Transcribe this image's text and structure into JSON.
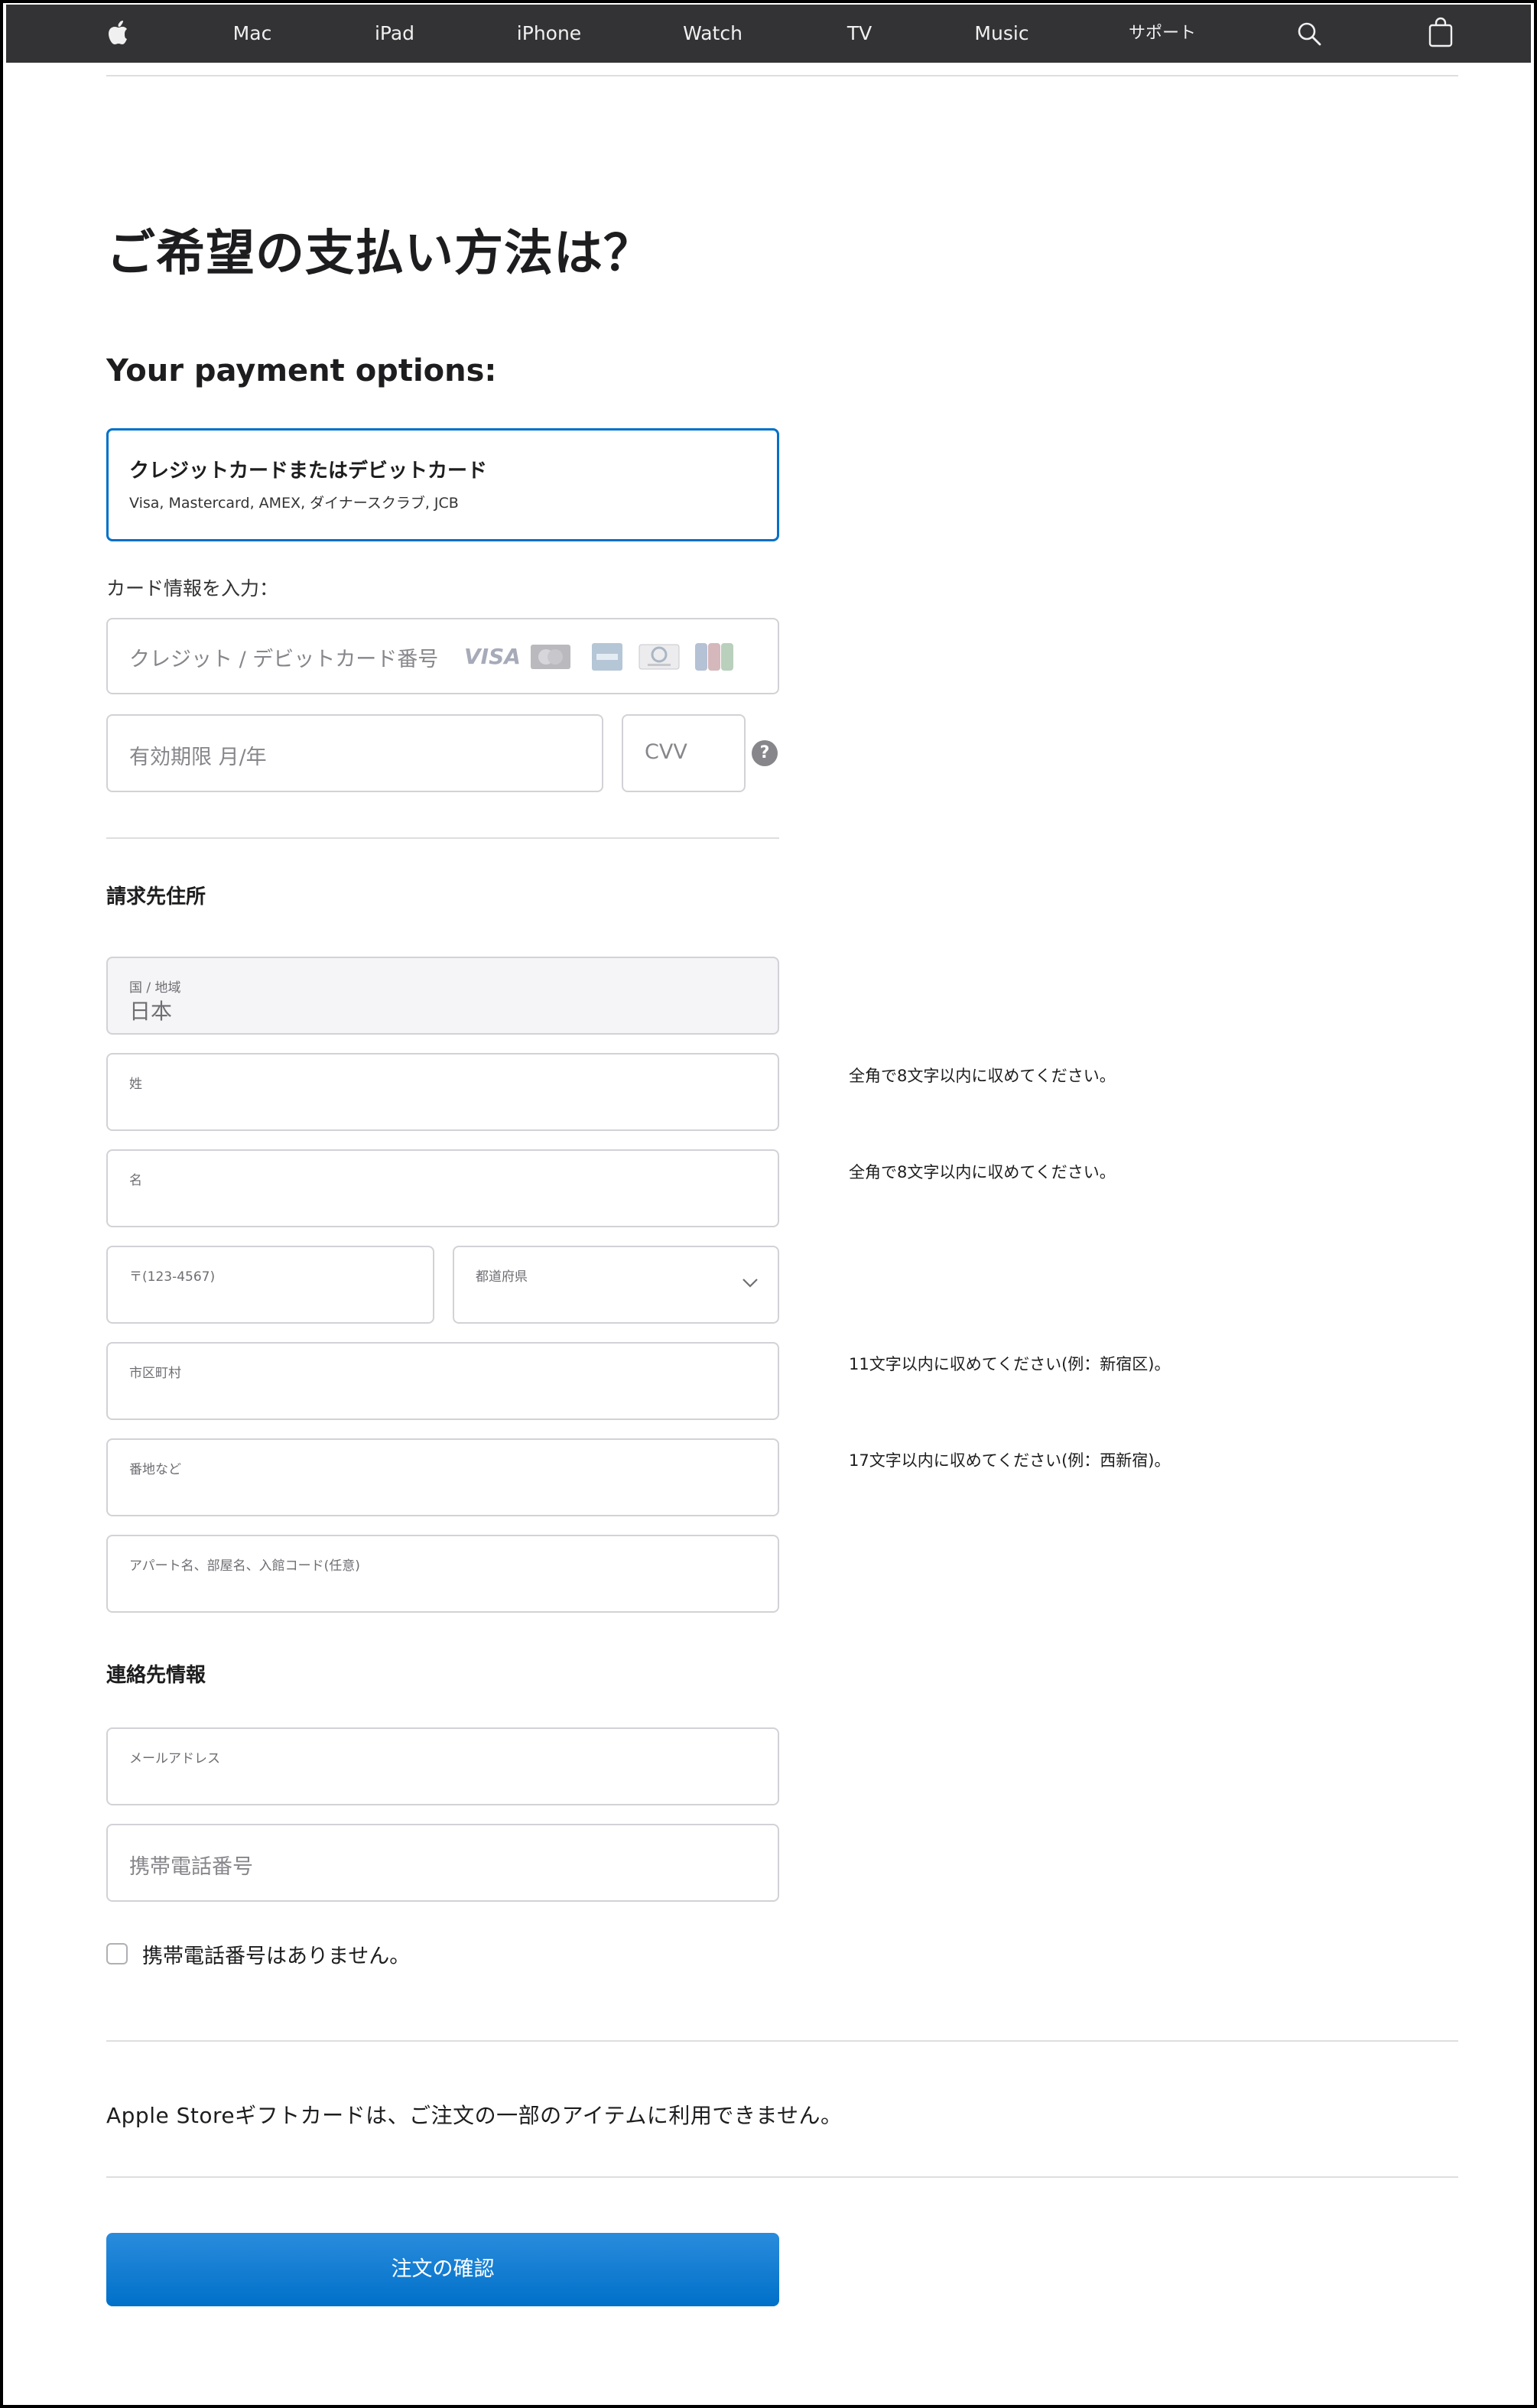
{
  "nav": {
    "items": [
      "Mac",
      "iPad",
      "iPhone",
      "Watch",
      "TV",
      "Music",
      "サポート"
    ],
    "icons": [
      "apple-logo-icon",
      "search-icon",
      "bag-icon"
    ]
  },
  "page": {
    "heading": "ご希望の支払い方法は？",
    "subheading": "Your payment options:"
  },
  "payment_option": {
    "title": "クレジットカードまたはデビットカード",
    "subtitle": "Visa, Mastercard, AMEX, ダイナースクラブ, JCB"
  },
  "card_info": {
    "label": "カード情報を入力：",
    "number_placeholder": "クレジット / デビットカード番号",
    "brand_logos": [
      "VISA",
      "Mastercard",
      "AMEX",
      "Diners Club",
      "JCB"
    ],
    "expiry_placeholder": "有効期限 月/年",
    "cvv_placeholder": "CVV",
    "cvv_help": "?"
  },
  "billing": {
    "title": "請求先住所",
    "country_label": "国 / 地域",
    "country_value": "日本",
    "last_name_label": "姓",
    "last_name_hint": "全角で8文字以内に収めてください。",
    "first_name_label": "名",
    "first_name_hint": "全角で8文字以内に収めてください。",
    "postal_label": "〒(123-4567)",
    "prefecture_label": "都道府県",
    "city_label": "市区町村",
    "city_hint": "11文字以内に収めてください(例：新宿区)。",
    "street_label": "番地など",
    "street_hint": "17文字以内に収めてください(例：西新宿)。",
    "building_label": "アパート名、部屋名、入館コード(任意)"
  },
  "contact": {
    "title": "連絡先情報",
    "email_label": "メールアドレス",
    "phone_placeholder": "携帯電話番号",
    "no_phone_label": "携帯電話番号はありません。"
  },
  "gift_card_note": "Apple Storeギフトカードは、ご注文の一部のアイテムに利用できません。",
  "confirm_button": "注文の確認",
  "colors": {
    "accent": "#0070c9",
    "nav_bg": "#333335",
    "field_border": "#d2d2d7"
  }
}
